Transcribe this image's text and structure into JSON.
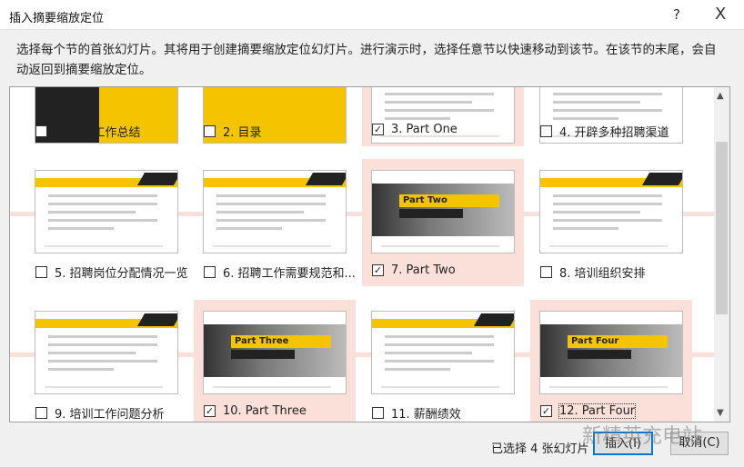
{
  "dialog": {
    "title": "插入摘要缩放定位",
    "help_label": "?",
    "close_label": "X",
    "description": "选择每个节的首张幻灯片。其将用于创建摘要缩放定位幻灯片。进行演示时，选择任意节以快速移动到该节。在该节的末尾，会自动返回到摘要缩放定位。"
  },
  "slides": [
    {
      "label": "1. 年终工作总结",
      "checked": false,
      "kind": "cover"
    },
    {
      "label": "2. 目录",
      "checked": false,
      "kind": "toc"
    },
    {
      "label": "3. Part One",
      "checked": true,
      "kind": "content"
    },
    {
      "label": "4. 开辟多种招聘渠道",
      "checked": false,
      "kind": "content"
    },
    {
      "label": "5. 招聘岗位分配情况一览",
      "checked": false,
      "kind": "content"
    },
    {
      "label": "6. 招聘工作需要规范和...",
      "checked": false,
      "kind": "content"
    },
    {
      "label": "7. Part Two",
      "checked": true,
      "kind": "section",
      "slide_title": "Part Two"
    },
    {
      "label": "8. 培训组织安排",
      "checked": false,
      "kind": "content"
    },
    {
      "label": "9. 培训工作问题分析",
      "checked": false,
      "kind": "content"
    },
    {
      "label": "10. Part Three",
      "checked": true,
      "kind": "section",
      "slide_title": "Part Three"
    },
    {
      "label": "11. 薪酬绩效",
      "checked": false,
      "kind": "content"
    },
    {
      "label": "12. Part Four",
      "checked": true,
      "kind": "section",
      "slide_title": "Part Four"
    }
  ],
  "footer": {
    "selected_count": "已选择 4 张幻灯片",
    "insert_label": "插入(I)",
    "cancel_label": "取消(C)"
  },
  "watermark": "新精英充电站",
  "colors": {
    "highlight": "#fbe0da",
    "accent": "#f5c400",
    "focus": "#0078d7"
  }
}
